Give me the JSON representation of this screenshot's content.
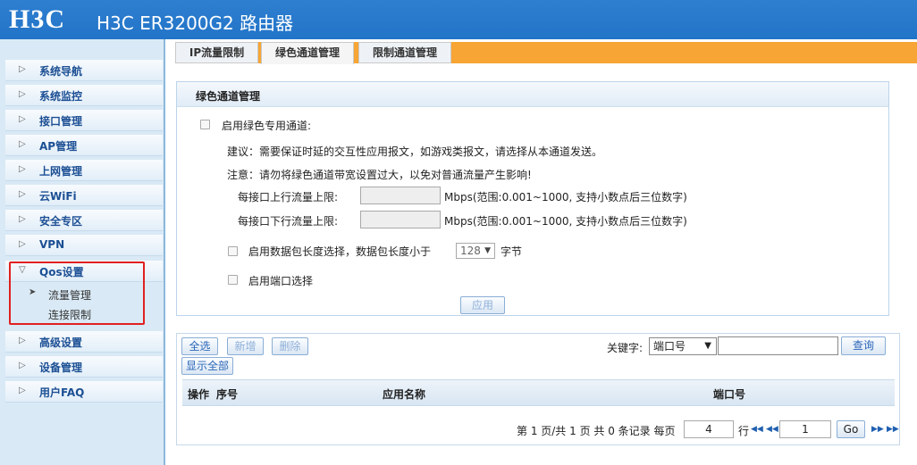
{
  "header": {
    "logo": "H3C",
    "title": "H3C ER3200G2 路由器"
  },
  "sidebar": {
    "items": [
      {
        "label": "系统导航"
      },
      {
        "label": "系统监控"
      },
      {
        "label": "接口管理"
      },
      {
        "label": "AP管理"
      },
      {
        "label": "上网管理"
      },
      {
        "label": "云WiFi"
      },
      {
        "label": "安全专区"
      },
      {
        "label": "VPN"
      },
      {
        "label": "Qos设置",
        "expanded": true
      },
      {
        "label": "高级设置"
      },
      {
        "label": "设备管理"
      },
      {
        "label": "用户FAQ"
      }
    ],
    "qos_sub": [
      {
        "label": "流量管理",
        "selected": true
      },
      {
        "label": "连接限制"
      }
    ]
  },
  "tabs": [
    {
      "label": "IP流量限制"
    },
    {
      "label": "绿色通道管理",
      "active": true
    },
    {
      "label": "限制通道管理"
    }
  ],
  "panel": {
    "title": "绿色通道管理",
    "enable_label": "启用绿色专用通道:",
    "advice": "建议：需要保证时延的交互性应用报文，如游戏类报文，请选择从本通道发送。",
    "note": "注意：请勿将绿色通道带宽设置过大，以免对普通流量产生影响!",
    "up_label": "每接口上行流量上限:",
    "up_value": "",
    "up_unit": "Mbps(范围:0.001~1000, 支持小数点后三位数字)",
    "down_label": "每接口下行流量上限:",
    "down_value": "",
    "down_unit": "Mbps(范围:0.001~1000, 支持小数点后三位数字)",
    "pkt_label": "启用数据包长度选择，数据包长度小于",
    "pkt_value": "128",
    "pkt_unit": "字节",
    "port_label": "启用端口选择",
    "apply": "应用"
  },
  "list": {
    "buttons": {
      "select_all": "全选",
      "add": "新增",
      "delete": "删除",
      "show_all": "显示全部"
    },
    "keyword_label": "关键字:",
    "keyword_option": "端口号",
    "keyword_value": "",
    "query": "查询",
    "columns": [
      "操作",
      "序号",
      "应用名称",
      "端口号"
    ],
    "pager": {
      "summary": "第 1 页/共 1 页 共 0 条记录 每页",
      "per_page": "4",
      "row_unit": "行",
      "page": "1",
      "go": "Go"
    }
  },
  "colors": {
    "header": "#2274c8",
    "tab_bar": "#f7a534",
    "highlight_box": "#e02020"
  }
}
